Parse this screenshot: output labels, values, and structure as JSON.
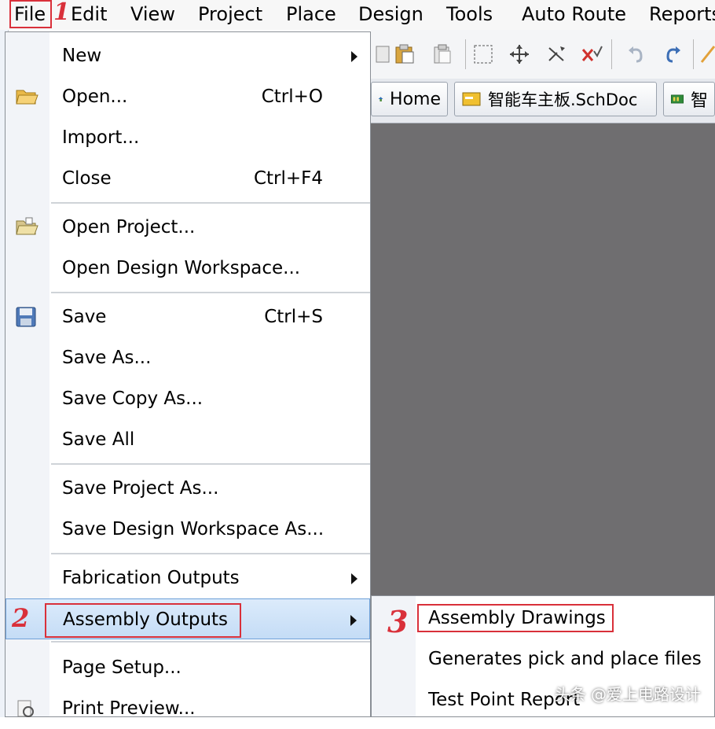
{
  "menubar": {
    "items": [
      "File",
      "Edit",
      "View",
      "Project",
      "Place",
      "Design",
      "Tools",
      "Auto Route",
      "Reports"
    ]
  },
  "tabs": [
    {
      "label": "Home",
      "icon": "home-icon"
    },
    {
      "label": "智能车主板.SchDoc",
      "icon": "schematic-doc-icon"
    },
    {
      "label": "智",
      "icon": "pcb-doc-icon"
    }
  ],
  "file_menu": {
    "items": [
      {
        "label": "New",
        "submenu": true
      },
      {
        "label": "Open...",
        "shortcut": "Ctrl+O",
        "icon": "open-folder-icon"
      },
      {
        "label": "Import..."
      },
      {
        "label": "Close",
        "shortcut": "Ctrl+F4"
      },
      {
        "label": "Open Project...",
        "icon": "open-project-icon"
      },
      {
        "label": "Open Design Workspace..."
      },
      {
        "label": "Save",
        "shortcut": "Ctrl+S",
        "icon": "save-disk-icon"
      },
      {
        "label": "Save As..."
      },
      {
        "label": "Save Copy As..."
      },
      {
        "label": "Save All"
      },
      {
        "label": "Save Project As..."
      },
      {
        "label": "Save Design Workspace As..."
      },
      {
        "label": "Fabrication Outputs",
        "submenu": true
      },
      {
        "label": "Assembly Outputs",
        "submenu": true,
        "highlighted": true
      },
      {
        "label": "Page Setup..."
      },
      {
        "label": "Print Preview...",
        "icon": "print-preview-icon"
      }
    ]
  },
  "assembly_submenu": {
    "items": [
      {
        "label": "Assembly Drawings"
      },
      {
        "label": "Generates pick and place files"
      },
      {
        "label": "Test Point Report"
      }
    ]
  },
  "annotations": {
    "step1": "1",
    "step2": "2",
    "step3": "3"
  },
  "watermark": "头条 @爱上电路设计",
  "colors": {
    "highlight": "#c4dcf6",
    "annotation_red": "#d9303a",
    "workspace": "#6f6e70"
  }
}
